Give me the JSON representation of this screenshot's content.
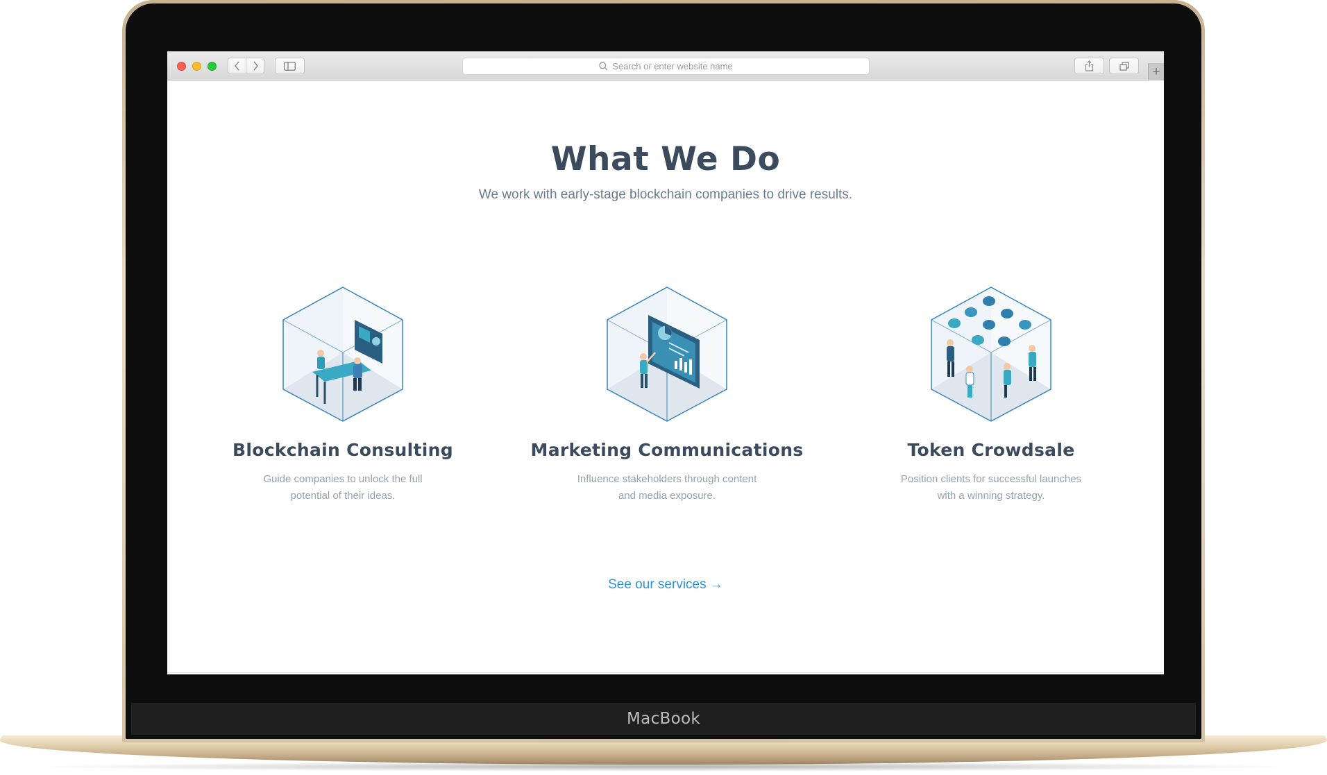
{
  "device": {
    "brand": "MacBook"
  },
  "browser": {
    "address_placeholder": "Search or enter website name",
    "icons": {
      "back": "chevron-left-icon",
      "forward": "chevron-right-icon",
      "sidebar": "sidebar-icon",
      "search": "search-icon",
      "share": "share-icon",
      "tabs": "tabs-icon",
      "new_tab": "plus-icon"
    }
  },
  "page": {
    "title": "What We Do",
    "subtitle": "We work with early-stage blockchain companies to drive results.",
    "cards": [
      {
        "title": "Blockchain Consulting",
        "description": "Guide companies to unlock the full potential of their ideas.",
        "icon": "consulting-cube-illustration"
      },
      {
        "title": "Marketing Communications",
        "description": "Influence stakeholders through content and media exposure.",
        "icon": "marketing-cube-illustration"
      },
      {
        "title": "Token Crowdsale",
        "description": "Position clients for successful launches with a winning strategy.",
        "icon": "crowdsale-cube-illustration"
      }
    ],
    "cta": "See our services →"
  },
  "colors": {
    "heading": "#3b4a5c",
    "body_text": "#95a1ae",
    "link": "#3191d6",
    "cube_stroke": "#3a86bf",
    "accent_teal": "#3aa9c4",
    "laptop_gold": "#e2cfae"
  }
}
